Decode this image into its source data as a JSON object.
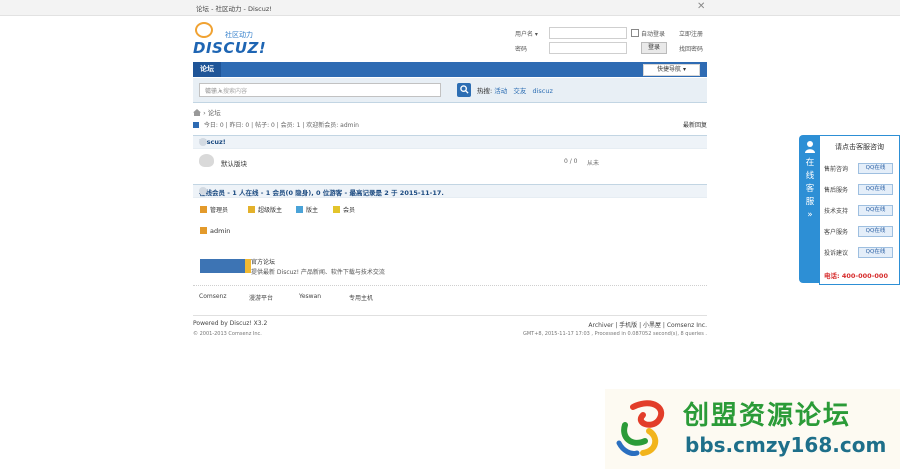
{
  "window": {
    "title": "论坛 - 社区动力 - Discuz!",
    "close_label": "✕"
  },
  "logo": {
    "tagline": "社区动力",
    "wordmark": "DISCUZ!"
  },
  "login": {
    "username_label": "用户名 ▾",
    "username_placeholder": "",
    "password_label": "密码",
    "password_placeholder": "",
    "remember_label": "自动登录",
    "login_button": "登录",
    "register_link": "立即注册",
    "forgot_link": "找回密码"
  },
  "nav": {
    "active_item": "论坛",
    "quick_nav": "快捷导航 ▾"
  },
  "search": {
    "placeholder": "请输入搜索内容",
    "scope": "帖子 ▾",
    "button_icon": "search-icon",
    "hot_label": "热搜:",
    "hot_terms": [
      "活动",
      "交友",
      "discuz"
    ]
  },
  "breadcrumb": {
    "home_icon": "home-icon",
    "separator": "›",
    "current": "论坛"
  },
  "stats": {
    "text": "今日: 0 | 昨日: 0 | 帖子: 0 | 会员: 1 | 欢迎新会员: admin",
    "new_posts": "最新回复"
  },
  "categories": [
    {
      "name": "Discuz!",
      "forums": [
        {
          "name": "默认版块",
          "counts": "0 / 0",
          "last_post": "从未"
        }
      ]
    }
  ],
  "online": {
    "header": "在线会员 - 1 人在线 - 1 会员(0 隐身), 0 位游客 - 最高记录是 2 于 2015-11-17.",
    "legend": [
      {
        "label": "管理员",
        "color": "#e39a2b"
      },
      {
        "label": "超级版主",
        "color": "#e3b12b"
      },
      {
        "label": "版主",
        "color": "#4aa3d8"
      },
      {
        "label": "会员",
        "color": "#e3c42b"
      }
    ],
    "users": [
      "admin"
    ]
  },
  "partner": {
    "title": "官方论坛",
    "description": "提供最新 Discuz! 产品新闻、软件下载与技术交流"
  },
  "friend_links": [
    "Comsenz",
    "漫游平台",
    "Yeswan",
    "专用主机"
  ],
  "footer": {
    "powered": "Powered by Discuz! X3.2",
    "copyright": "© 2001-2013 Comsenz Inc.",
    "links": "Archiver | 手机版 | 小黑屋 | Comsenz Inc.",
    "gmt": "GMT+8, 2015-11-17 17:03 , Processed in 0.087052 second(s), 8 queries ."
  },
  "customer_service": {
    "tab_label": "在线客服 »",
    "title": "请点击客服咨询",
    "rows": [
      {
        "label": "售前咨询",
        "button": "QQ在线"
      },
      {
        "label": "售后服务",
        "button": "QQ在线"
      },
      {
        "label": "技术支持",
        "button": "QQ在线"
      },
      {
        "label": "客户服务",
        "button": "QQ在线"
      },
      {
        "label": "投诉建议",
        "button": "QQ在线"
      }
    ],
    "phone": "电话: 400-000-000"
  },
  "watermark": {
    "name": "创盟资源论坛",
    "url": "bbs.cmzy168.com"
  },
  "colors": {
    "nav_blue": "#2e6bb3",
    "cs_blue": "#2d8fd5",
    "watermark_green": "#2b9b38"
  }
}
